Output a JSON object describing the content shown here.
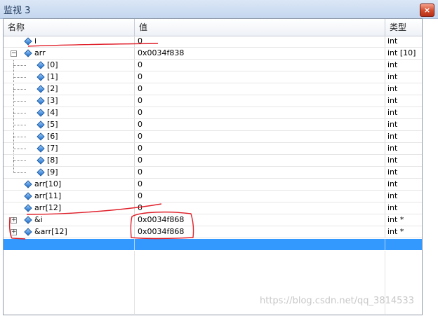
{
  "window": {
    "title": "监视 3",
    "close_glyph": "×"
  },
  "columns": {
    "name": "名称",
    "value": "值",
    "type": "类型"
  },
  "rows": [
    {
      "name": "i",
      "value": "0",
      "type": "int"
    },
    {
      "name": "arr",
      "value": "0x0034f838",
      "type": "int [10]",
      "toggle": "−"
    },
    {
      "name": "[0]",
      "value": "0",
      "type": "int"
    },
    {
      "name": "[1]",
      "value": "0",
      "type": "int"
    },
    {
      "name": "[2]",
      "value": "0",
      "type": "int"
    },
    {
      "name": "[3]",
      "value": "0",
      "type": "int"
    },
    {
      "name": "[4]",
      "value": "0",
      "type": "int"
    },
    {
      "name": "[5]",
      "value": "0",
      "type": "int"
    },
    {
      "name": "[6]",
      "value": "0",
      "type": "int"
    },
    {
      "name": "[7]",
      "value": "0",
      "type": "int"
    },
    {
      "name": "[8]",
      "value": "0",
      "type": "int"
    },
    {
      "name": "[9]",
      "value": "0",
      "type": "int"
    },
    {
      "name": "arr[10]",
      "value": "0",
      "type": "int"
    },
    {
      "name": "arr[11]",
      "value": "0",
      "type": "int"
    },
    {
      "name": "arr[12]",
      "value": "0",
      "type": "int"
    },
    {
      "name": "&i",
      "value": "0x0034f868",
      "type": "int *",
      "toggle": "+"
    },
    {
      "name": "&arr[12]",
      "value": "0x0034f868",
      "type": "int *",
      "toggle": "+"
    }
  ],
  "watermark": "https://blog.csdn.net/qq_3814533",
  "colors": {
    "selection": "#3399ff",
    "annotation": "#e0202a",
    "icon": "#1b6ed0"
  }
}
